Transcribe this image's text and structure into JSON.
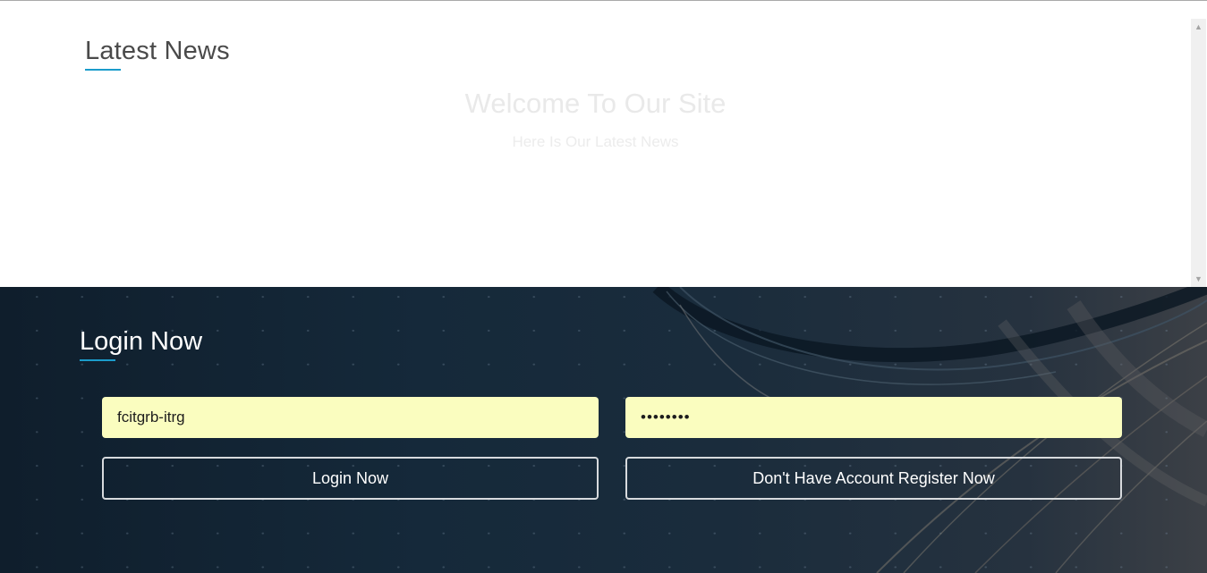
{
  "news": {
    "title": "Latest News",
    "welcome_heading": "Welcome To Our Site",
    "welcome_subheading": "Here Is Our Latest News"
  },
  "login": {
    "title": "Login Now",
    "username_value": "fcitgrb-itrg",
    "password_value": "••••••••",
    "login_button_label": "Login Now",
    "register_button_label": "Don't Have Account Register Now"
  },
  "scrollbar": {
    "up_arrow": "▲",
    "down_arrow": "▼"
  },
  "colors": {
    "accent": "#1b9ccb",
    "input_background": "#fafdbf",
    "login_background": "#15293a"
  }
}
